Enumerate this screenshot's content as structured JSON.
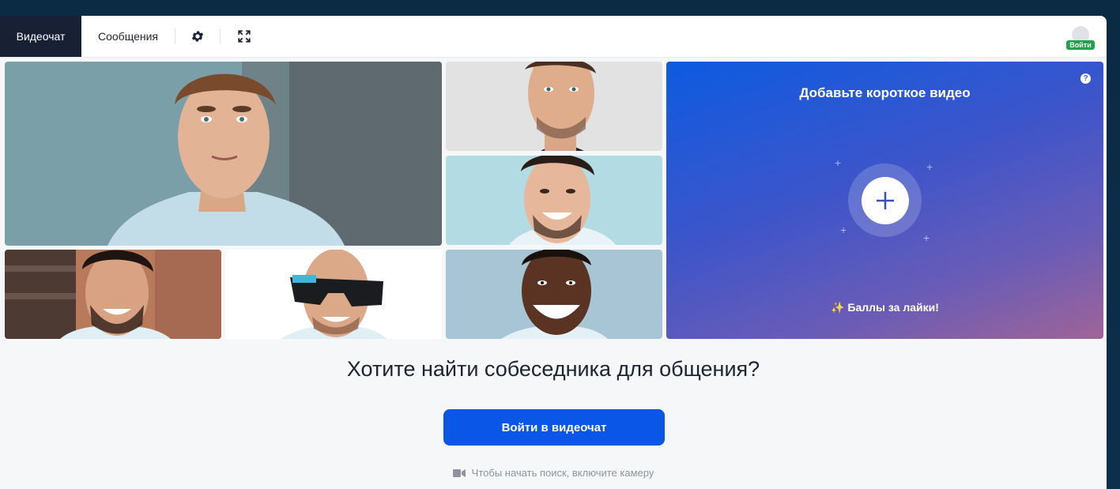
{
  "tabs": {
    "video": "Видеочат",
    "messages": "Сообщения"
  },
  "header": {
    "login_badge": "Войти"
  },
  "promo": {
    "title": "Добавьте короткое видео",
    "help": "?",
    "likes": "Баллы за лайки!"
  },
  "main": {
    "headline": "Хотите найти собеседника для общения?",
    "cta": "Войти в видеочат",
    "hint": "Чтобы начать поиск, включите камеру"
  },
  "colors": {
    "accent": "#0a56e6",
    "dark_tab": "#182034",
    "badge": "#1fa34a"
  },
  "icons": [
    "gear-icon",
    "fullscreen-icon",
    "avatar-icon",
    "help-icon",
    "plus-icon",
    "sparkle-icon",
    "camera-icon"
  ]
}
